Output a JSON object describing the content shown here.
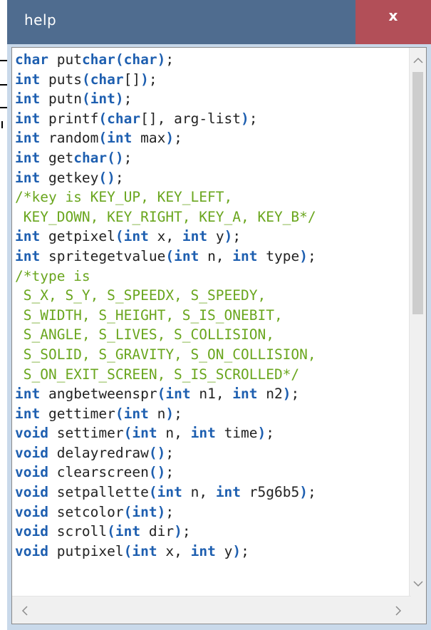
{
  "window": {
    "title": "help",
    "close_label": "x"
  },
  "scrollbar": {
    "up_icon": "chevron-up-icon",
    "down_icon": "chevron-down-icon",
    "left_icon": "chevron-left-icon",
    "right_icon": "chevron-right-icon",
    "up_glyph": "^",
    "down_glyph": "v",
    "left_glyph": "<",
    "right_glyph": ">",
    "vertical_position": 0.0
  },
  "colors": {
    "titlebar": "#4f6c8f",
    "close_button": "#b24f58",
    "keyword": "#1e5fb0",
    "comment": "#6aa61e",
    "text": "#222222"
  },
  "code_lines": [
    [
      {
        "t": "kw",
        "s": "char"
      },
      {
        "t": "tx",
        "s": " put"
      },
      {
        "t": "kw",
        "s": "char"
      },
      {
        "t": "kw",
        "s": "("
      },
      {
        "t": "kw",
        "s": "char"
      },
      {
        "t": "kw",
        "s": ")"
      },
      {
        "t": "tx",
        "s": ";"
      }
    ],
    [
      {
        "t": "kw",
        "s": "int"
      },
      {
        "t": "tx",
        "s": " puts"
      },
      {
        "t": "kw",
        "s": "("
      },
      {
        "t": "kw",
        "s": "char"
      },
      {
        "t": "tx",
        "s": "[]"
      },
      {
        "t": "kw",
        "s": ")"
      },
      {
        "t": "tx",
        "s": ";"
      }
    ],
    [
      {
        "t": "kw",
        "s": "int"
      },
      {
        "t": "tx",
        "s": " putn"
      },
      {
        "t": "kw",
        "s": "("
      },
      {
        "t": "kw",
        "s": "int"
      },
      {
        "t": "kw",
        "s": ")"
      },
      {
        "t": "tx",
        "s": ";"
      }
    ],
    [
      {
        "t": "kw",
        "s": "int"
      },
      {
        "t": "tx",
        "s": " printf"
      },
      {
        "t": "kw",
        "s": "("
      },
      {
        "t": "kw",
        "s": "char"
      },
      {
        "t": "tx",
        "s": "[], arg-list"
      },
      {
        "t": "kw",
        "s": ")"
      },
      {
        "t": "tx",
        "s": ";"
      }
    ],
    [
      {
        "t": "kw",
        "s": "int"
      },
      {
        "t": "tx",
        "s": " random"
      },
      {
        "t": "kw",
        "s": "("
      },
      {
        "t": "kw",
        "s": "int"
      },
      {
        "t": "tx",
        "s": " max"
      },
      {
        "t": "kw",
        "s": ")"
      },
      {
        "t": "tx",
        "s": ";"
      }
    ],
    [
      {
        "t": "kw",
        "s": "int"
      },
      {
        "t": "tx",
        "s": " get"
      },
      {
        "t": "kw",
        "s": "char"
      },
      {
        "t": "kw",
        "s": "()"
      },
      {
        "t": "tx",
        "s": ";"
      }
    ],
    [
      {
        "t": "kw",
        "s": "int"
      },
      {
        "t": "tx",
        "s": " getkey"
      },
      {
        "t": "kw",
        "s": "()"
      },
      {
        "t": "tx",
        "s": ";"
      }
    ],
    [
      {
        "t": "cm",
        "s": "/*key is KEY_UP, KEY_LEFT,"
      }
    ],
    [
      {
        "t": "cm",
        "s": " KEY_DOWN, KEY_RIGHT, KEY_A, KEY_B*/"
      }
    ],
    [
      {
        "t": "kw",
        "s": "int"
      },
      {
        "t": "tx",
        "s": " getpixel"
      },
      {
        "t": "kw",
        "s": "("
      },
      {
        "t": "kw",
        "s": "int"
      },
      {
        "t": "tx",
        "s": " x, "
      },
      {
        "t": "kw",
        "s": "int"
      },
      {
        "t": "tx",
        "s": " y"
      },
      {
        "t": "kw",
        "s": ")"
      },
      {
        "t": "tx",
        "s": ";"
      }
    ],
    [
      {
        "t": "kw",
        "s": "int"
      },
      {
        "t": "tx",
        "s": " spritegetvalue"
      },
      {
        "t": "kw",
        "s": "("
      },
      {
        "t": "kw",
        "s": "int"
      },
      {
        "t": "tx",
        "s": " n, "
      },
      {
        "t": "kw",
        "s": "int"
      },
      {
        "t": "tx",
        "s": " type"
      },
      {
        "t": "kw",
        "s": ")"
      },
      {
        "t": "tx",
        "s": ";"
      }
    ],
    [
      {
        "t": "cm",
        "s": "/*type is"
      }
    ],
    [
      {
        "t": "cm",
        "s": " S_X, S_Y, S_SPEEDX, S_SPEEDY,"
      }
    ],
    [
      {
        "t": "cm",
        "s": " S_WIDTH, S_HEIGHT, S_IS_ONEBIT,"
      }
    ],
    [
      {
        "t": "cm",
        "s": " S_ANGLE, S_LIVES, S_COLLISION,"
      }
    ],
    [
      {
        "t": "cm",
        "s": " S_SOLID, S_GRAVITY, S_ON_COLLISION,"
      }
    ],
    [
      {
        "t": "cm",
        "s": " S_ON_EXIT_SCREEN, S_IS_SCROLLED*/"
      }
    ],
    [
      {
        "t": "kw",
        "s": "int"
      },
      {
        "t": "tx",
        "s": " angbetweenspr"
      },
      {
        "t": "kw",
        "s": "("
      },
      {
        "t": "kw",
        "s": "int"
      },
      {
        "t": "tx",
        "s": " n1, "
      },
      {
        "t": "kw",
        "s": "int"
      },
      {
        "t": "tx",
        "s": " n2"
      },
      {
        "t": "kw",
        "s": ")"
      },
      {
        "t": "tx",
        "s": ";"
      }
    ],
    [
      {
        "t": "kw",
        "s": "int"
      },
      {
        "t": "tx",
        "s": " gettimer"
      },
      {
        "t": "kw",
        "s": "("
      },
      {
        "t": "kw",
        "s": "int"
      },
      {
        "t": "tx",
        "s": " n"
      },
      {
        "t": "kw",
        "s": ")"
      },
      {
        "t": "tx",
        "s": ";"
      }
    ],
    [
      {
        "t": "kw",
        "s": "void"
      },
      {
        "t": "tx",
        "s": " settimer"
      },
      {
        "t": "kw",
        "s": "("
      },
      {
        "t": "kw",
        "s": "int"
      },
      {
        "t": "tx",
        "s": " n, "
      },
      {
        "t": "kw",
        "s": "int"
      },
      {
        "t": "tx",
        "s": " time"
      },
      {
        "t": "kw",
        "s": ")"
      },
      {
        "t": "tx",
        "s": ";"
      }
    ],
    [
      {
        "t": "kw",
        "s": "void"
      },
      {
        "t": "tx",
        "s": " delayredraw"
      },
      {
        "t": "kw",
        "s": "()"
      },
      {
        "t": "tx",
        "s": ";"
      }
    ],
    [
      {
        "t": "kw",
        "s": "void"
      },
      {
        "t": "tx",
        "s": " clearscreen"
      },
      {
        "t": "kw",
        "s": "()"
      },
      {
        "t": "tx",
        "s": ";"
      }
    ],
    [
      {
        "t": "kw",
        "s": "void"
      },
      {
        "t": "tx",
        "s": " setpallette"
      },
      {
        "t": "kw",
        "s": "("
      },
      {
        "t": "kw",
        "s": "int"
      },
      {
        "t": "tx",
        "s": " n, "
      },
      {
        "t": "kw",
        "s": "int"
      },
      {
        "t": "tx",
        "s": " r5g6b5"
      },
      {
        "t": "kw",
        "s": ")"
      },
      {
        "t": "tx",
        "s": ";"
      }
    ],
    [
      {
        "t": "kw",
        "s": "void"
      },
      {
        "t": "tx",
        "s": " setcolor"
      },
      {
        "t": "kw",
        "s": "("
      },
      {
        "t": "kw",
        "s": "int"
      },
      {
        "t": "kw",
        "s": ")"
      },
      {
        "t": "tx",
        "s": ";"
      }
    ],
    [
      {
        "t": "kw",
        "s": "void"
      },
      {
        "t": "tx",
        "s": " scroll"
      },
      {
        "t": "kw",
        "s": "("
      },
      {
        "t": "kw",
        "s": "int"
      },
      {
        "t": "tx",
        "s": " dir"
      },
      {
        "t": "kw",
        "s": ")"
      },
      {
        "t": "tx",
        "s": ";"
      }
    ],
    [
      {
        "t": "kw",
        "s": "void"
      },
      {
        "t": "tx",
        "s": " putpixel"
      },
      {
        "t": "kw",
        "s": "("
      },
      {
        "t": "kw",
        "s": "int"
      },
      {
        "t": "tx",
        "s": " x, "
      },
      {
        "t": "kw",
        "s": "int"
      },
      {
        "t": "tx",
        "s": " y"
      },
      {
        "t": "kw",
        "s": ")"
      },
      {
        "t": "tx",
        "s": ";"
      }
    ]
  ]
}
